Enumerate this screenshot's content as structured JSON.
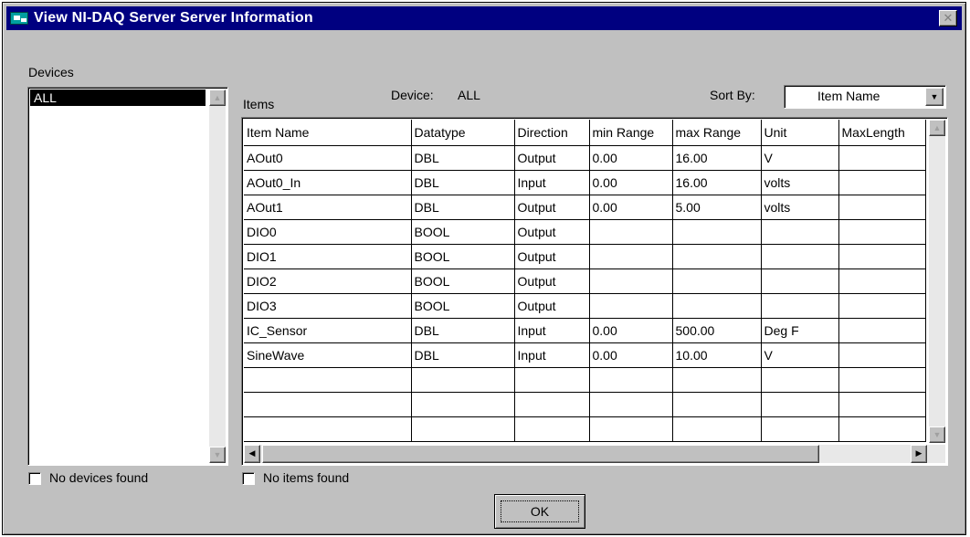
{
  "window": {
    "title": "View NI-DAQ Server Server Information",
    "close_glyph": "✕"
  },
  "devices": {
    "label": "Devices",
    "items": [
      "ALL"
    ],
    "empty_checkbox_label": "No devices found"
  },
  "items": {
    "label": "Items",
    "device_caption": "Device:",
    "device_value": "ALL",
    "sort_label": "Sort By:",
    "sort_value": "Item Name",
    "empty_checkbox_label": "No items found",
    "columns": [
      "Item Name",
      "Datatype",
      "Direction",
      "min Range",
      "max Range",
      "Unit",
      "MaxLength"
    ],
    "rows": [
      [
        "AOut0",
        "DBL",
        "Output",
        "0.00",
        "16.00",
        "V",
        ""
      ],
      [
        "AOut0_In",
        "DBL",
        "Input",
        "0.00",
        "16.00",
        "volts",
        ""
      ],
      [
        "AOut1",
        "DBL",
        "Output",
        "0.00",
        "5.00",
        "volts",
        ""
      ],
      [
        "DIO0",
        "BOOL",
        "Output",
        "",
        "",
        "",
        ""
      ],
      [
        "DIO1",
        "BOOL",
        "Output",
        "",
        "",
        "",
        ""
      ],
      [
        "DIO2",
        "BOOL",
        "Output",
        "",
        "",
        "",
        ""
      ],
      [
        "DIO3",
        "BOOL",
        "Output",
        "",
        "",
        "",
        ""
      ],
      [
        "IC_Sensor",
        "DBL",
        "Input",
        "0.00",
        "500.00",
        "Deg F",
        ""
      ],
      [
        "SineWave",
        "DBL",
        "Input",
        "0.00",
        "10.00",
        "V",
        ""
      ],
      [
        "",
        "",
        "",
        "",
        "",
        "",
        ""
      ],
      [
        "",
        "",
        "",
        "",
        "",
        "",
        ""
      ],
      [
        "",
        "",
        "",
        "",
        "",
        "",
        ""
      ]
    ]
  },
  "buttons": {
    "ok_label": "OK"
  },
  "icons": {
    "app": "monitor-icon",
    "scroll_up": "▲",
    "scroll_down": "▼",
    "scroll_left": "◀",
    "scroll_right": "▶",
    "dropdown": "▼"
  },
  "colors": {
    "titlebar": "#000080",
    "face": "#c0c0c0",
    "selection": "#000000"
  }
}
